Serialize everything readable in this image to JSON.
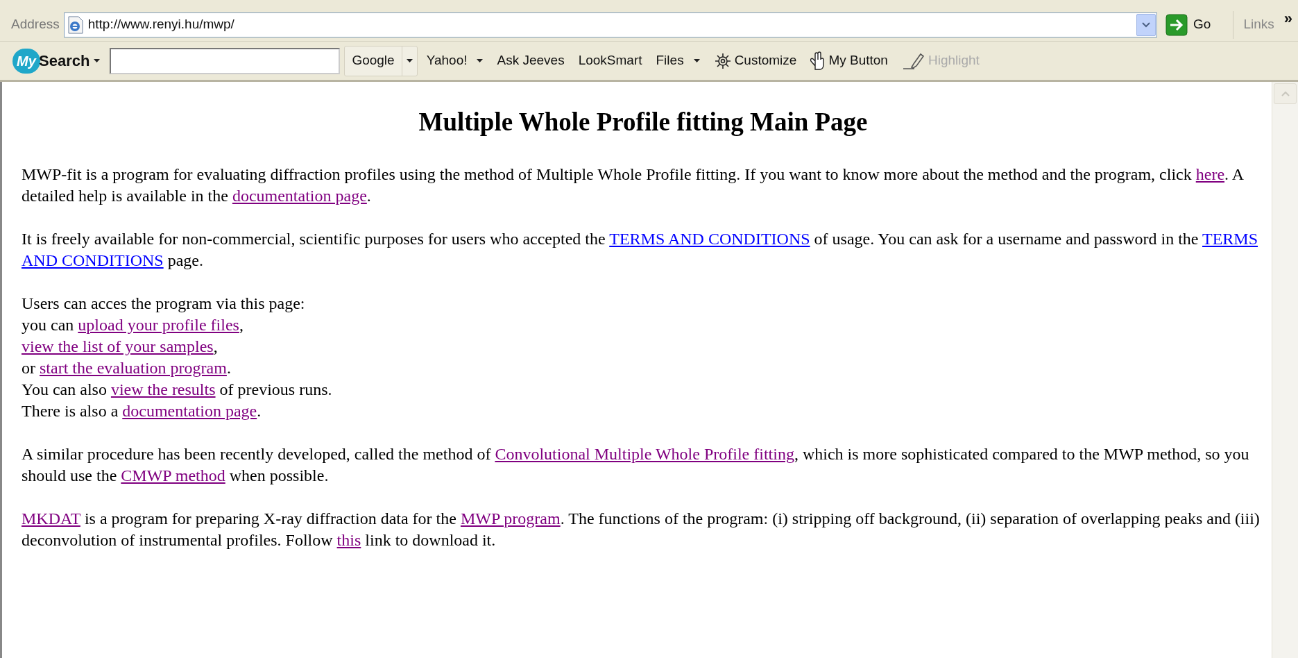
{
  "address_bar": {
    "label": "Address",
    "url": "http://www.renyi.hu/mwp/",
    "go": "Go",
    "links": "Links",
    "more": "»"
  },
  "search_toolbar": {
    "logo_my": "My",
    "logo_search": "Search",
    "buttons": [
      {
        "label": "Google",
        "kind": "split",
        "disabled": false
      },
      {
        "label": "Yahoo!",
        "kind": "menu",
        "disabled": false
      },
      {
        "label": "Ask Jeeves",
        "kind": "plain",
        "disabled": false
      },
      {
        "label": "LookSmart",
        "kind": "plain",
        "disabled": false
      },
      {
        "label": "Files",
        "kind": "menu",
        "disabled": false
      },
      {
        "label": "Customize",
        "kind": "gear",
        "disabled": false
      },
      {
        "label": "My Button",
        "kind": "hand",
        "disabled": false
      },
      {
        "label": "Highlight",
        "kind": "pen",
        "disabled": true
      }
    ]
  },
  "page": {
    "title": "Multiple Whole Profile fitting Main Page",
    "paragraphs": [
      {
        "lines": [
          [
            {
              "text": "MWP-fit is a program for evaluating diffraction profiles using the method of Multiple Whole Profile fitting. If you want to know more about the method and the program, click "
            },
            {
              "text": "here",
              "link": true,
              "visited": true
            },
            {
              "text": ". A"
            }
          ],
          [
            {
              "text": "detailed help is available in the "
            },
            {
              "text": "documentation page",
              "link": true,
              "visited": true
            },
            {
              "text": "."
            }
          ]
        ]
      },
      {
        "lines": [
          [
            {
              "text": "It is freely available for non-commercial, scientific purposes for users who accepted the "
            },
            {
              "text": "TERMS AND CONDITIONS",
              "link": true,
              "visited": false
            },
            {
              "text": " of usage. You can ask for a username and password in the "
            },
            {
              "text": "TERMS",
              "link": true,
              "visited": false
            }
          ],
          [
            {
              "text": "AND CONDITIONS",
              "link": true,
              "visited": false
            },
            {
              "text": " page."
            }
          ]
        ]
      },
      {
        "lines": [
          [
            {
              "text": "Users can acces the program via this page:"
            }
          ],
          [
            {
              "text": "you can "
            },
            {
              "text": "upload your profile files",
              "link": true,
              "visited": true
            },
            {
              "text": ","
            }
          ],
          [
            {
              "text": "view the list of your samples",
              "link": true,
              "visited": true
            },
            {
              "text": ","
            }
          ],
          [
            {
              "text": "or "
            },
            {
              "text": "start the evaluation program",
              "link": true,
              "visited": true
            },
            {
              "text": "."
            }
          ],
          [
            {
              "text": "You can also "
            },
            {
              "text": "view the results",
              "link": true,
              "visited": true
            },
            {
              "text": " of previous runs."
            }
          ],
          [
            {
              "text": "There is also a "
            },
            {
              "text": "documentation page",
              "link": true,
              "visited": true
            },
            {
              "text": "."
            }
          ]
        ]
      },
      {
        "lines": [
          [
            {
              "text": "A similar procedure has been recently developed, called the method of "
            },
            {
              "text": "Convolutional Multiple Whole Profile fitting",
              "link": true,
              "visited": true
            },
            {
              "text": ", which is more sophisticated compared to the MWP method, so you"
            }
          ],
          [
            {
              "text": "should use the "
            },
            {
              "text": "CMWP method",
              "link": true,
              "visited": true
            },
            {
              "text": " when possible."
            }
          ]
        ]
      },
      {
        "lines": [
          [
            {
              "text": "MKDAT",
              "link": true,
              "visited": true
            },
            {
              "text": " is a program for preparing X-ray diffraction data for the "
            },
            {
              "text": "MWP program",
              "link": true,
              "visited": true
            },
            {
              "text": ". The functions of the program: (i) stripping off background, (ii) separation of overlapping peaks and (iii)"
            }
          ],
          [
            {
              "text": "deconvolution of instrumental profiles. Follow "
            },
            {
              "text": "this",
              "link": true,
              "visited": true
            },
            {
              "text": " link to download it."
            }
          ]
        ]
      }
    ]
  }
}
